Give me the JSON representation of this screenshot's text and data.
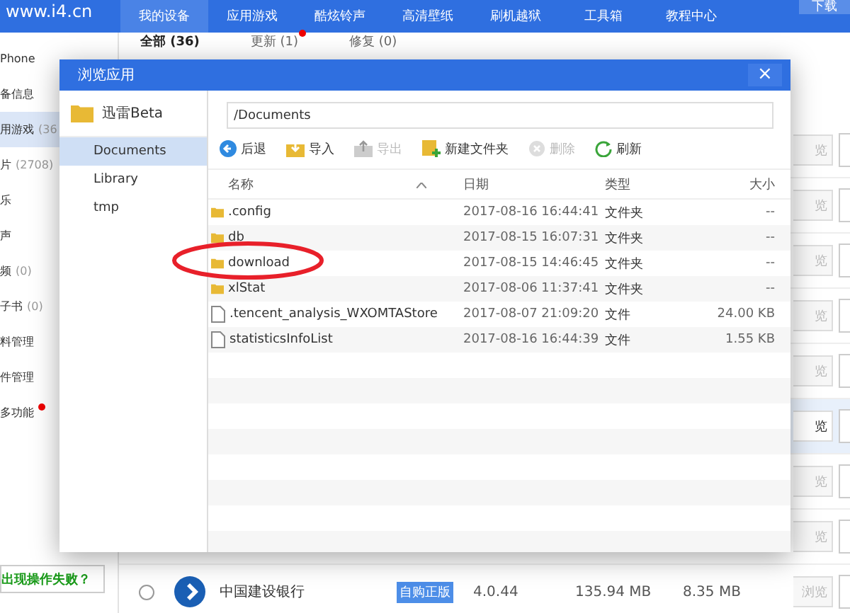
{
  "top_bar": {
    "logo": "www.i4.cn",
    "nav": [
      {
        "label": "我的设备",
        "selected": true
      },
      {
        "label": "应用游戏",
        "selected": false
      },
      {
        "label": "酷炫铃声",
        "selected": false
      },
      {
        "label": "高清壁纸",
        "selected": false
      },
      {
        "label": "刷机越狱",
        "selected": false
      },
      {
        "label": "工具箱",
        "selected": false
      },
      {
        "label": "教程中心",
        "selected": false
      }
    ],
    "download_button": "下载"
  },
  "sidebar": {
    "items": [
      {
        "label": "Phone",
        "selected": false
      },
      {
        "label": "备信息",
        "selected": false
      },
      {
        "label": "用游戏",
        "count": "(36",
        "selected": true
      },
      {
        "label": "片",
        "count": "(2708)",
        "selected": false
      },
      {
        "label": "乐",
        "selected": false
      },
      {
        "label": "声",
        "selected": false
      },
      {
        "label": "频",
        "count": "(0)",
        "selected": false
      },
      {
        "label": "子书",
        "count": "(0)",
        "selected": false
      },
      {
        "label": "料管理",
        "selected": false
      },
      {
        "label": "件管理",
        "selected": false
      },
      {
        "label": "多功能",
        "badge": true,
        "selected": false
      }
    ],
    "help_link": "出现操作失败？"
  },
  "tabs": [
    {
      "label": "全部 (36)",
      "selected": true,
      "badge": false
    },
    {
      "label": "更新 (1)",
      "selected": false,
      "badge": true
    },
    {
      "label": "修复 (0)",
      "selected": false,
      "badge": false
    }
  ],
  "app_rows": [
    {
      "button": "览",
      "selected": false
    },
    {
      "button": "览",
      "selected": false
    },
    {
      "button": "览",
      "selected": false
    },
    {
      "button": "览",
      "selected": false
    },
    {
      "button": "览",
      "selected": false
    },
    {
      "button": "览",
      "selected": true
    },
    {
      "button": "览",
      "selected": false
    },
    {
      "button": "览",
      "selected": false
    },
    {
      "button": "浏览",
      "selected": false,
      "checked": false,
      "name": "中国建设银行",
      "badge": "自购正版",
      "version": "4.0.44",
      "size": "135.94 MB",
      "data_size": "8.35 MB"
    }
  ],
  "dialog": {
    "title": "浏览应用",
    "close": "×",
    "app_name": "迅雷Beta",
    "folders": [
      {
        "label": "Documents",
        "selected": true
      },
      {
        "label": "Library",
        "selected": false
      },
      {
        "label": "tmp",
        "selected": false
      }
    ],
    "path": "/Documents",
    "toolbar": [
      {
        "kind": "back",
        "label": "后退",
        "disabled": false
      },
      {
        "kind": "import",
        "label": "导入",
        "disabled": false
      },
      {
        "kind": "export",
        "label": "导出",
        "disabled": true
      },
      {
        "kind": "new-folder",
        "label": "新建文件夹",
        "disabled": false
      },
      {
        "kind": "delete",
        "label": "删除",
        "disabled": true
      },
      {
        "kind": "refresh",
        "label": "刷新",
        "disabled": false
      }
    ],
    "columns": [
      "名称",
      "日期",
      "类型",
      "大小"
    ],
    "files": [
      {
        "kind": "folder",
        "name": ".config",
        "date": "2017-08-16 16:44:41",
        "type": "文件夹",
        "size": "--",
        "circled": false
      },
      {
        "kind": "folder",
        "name": "db",
        "date": "2017-08-15 16:07:31",
        "type": "文件夹",
        "size": "--",
        "circled": false
      },
      {
        "kind": "folder",
        "name": "download",
        "date": "2017-08-15 14:46:45",
        "type": "文件夹",
        "size": "--",
        "circled": true
      },
      {
        "kind": "folder",
        "name": "xlStat",
        "date": "2017-08-06 11:37:41",
        "type": "文件夹",
        "size": "--",
        "circled": false
      },
      {
        "kind": "file",
        "name": ".tencent_analysis_WXOMTAStore",
        "date": "2017-08-07 21:09:20",
        "type": "文件",
        "size": "24.00 KB",
        "circled": false
      },
      {
        "kind": "file",
        "name": "statisticsInfoList",
        "date": "2017-08-16 16:44:39",
        "type": "文件",
        "size": "1.55 KB",
        "circled": false
      }
    ]
  }
}
